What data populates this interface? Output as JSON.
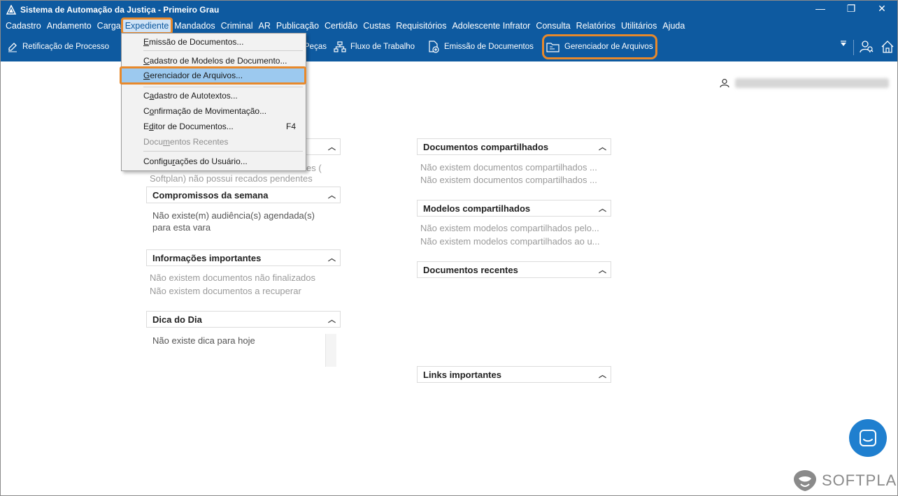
{
  "window": {
    "title": "Sistema de Automação da Justiça - Primeiro Grau",
    "controls": {
      "minimize": "—",
      "maximize": "❐",
      "close": "✕"
    }
  },
  "menubar": {
    "items": [
      "Cadastro",
      "Andamento",
      "Carga",
      "Expediente",
      "Mandados",
      "Criminal",
      "AR",
      "Publicação",
      "Certidão",
      "Custas",
      "Requisitórios",
      "Adolescente Infrator",
      "Consulta",
      "Relatórios",
      "Utilitários",
      "Ajuda"
    ],
    "active": "Expediente"
  },
  "toolbar": {
    "retificacao": "Retificação de Processo",
    "pecas": "Peças",
    "fluxo": "Fluxo de Trabalho",
    "emissao": "Emissão de Documentos",
    "gerenciador": "Gerenciador de Arquivos"
  },
  "dropdown": {
    "items": [
      {
        "label": "Emissão de Documentos...",
        "mnemonic": "E",
        "rest": "missão de Documentos..."
      },
      {
        "label": "Cadastro de Modelos de Documento...",
        "mnemonic": "C",
        "rest": "adastro de Modelos de Documento..."
      },
      {
        "label": "Gerenciador de Arquivos...",
        "mnemonic": "G",
        "rest": "erenciador de Arquivos..."
      },
      {
        "label": "Cadastro de Autotextos...",
        "pre": "C",
        "mnemonic": "a",
        "rest": "dastro de Autotextos..."
      },
      {
        "label": "Confirmação de Movimentação...",
        "pre": "C",
        "mnemonic": "o",
        "rest": "nfirmação de Movimentação..."
      },
      {
        "label": "Editor de Documentos...",
        "pre": "E",
        "mnemonic": "d",
        "rest": "itor de Documentos...",
        "shortcut": "F4"
      },
      {
        "label": "Documentos Recentes",
        "pre": "Docu",
        "mnemonic": "m",
        "rest": "entos Recentes"
      },
      {
        "label": "Configurações do Usuário...",
        "pre": "Configu",
        "mnemonic": "r",
        "rest": "ações do Usuário..."
      }
    ]
  },
  "left_panels": {
    "recados_line1_tail": "es (",
    "recados_line2": "Softplan) não possui recados pendentes",
    "compromissos": {
      "title": "Compromissos da semana",
      "text": "Não existe(m) audiência(s) agendada(s) para esta vara"
    },
    "informacoes": {
      "title": "Informações importantes",
      "lines": [
        "Não existem documentos não finalizados",
        "Não existem documentos a recuperar"
      ]
    },
    "dica": {
      "title": "Dica do Dia",
      "text": "Não existe dica para hoje"
    }
  },
  "right_panels": {
    "compartilhados": {
      "title": "Documentos compartilhados",
      "lines": [
        "Não existem documentos compartilhados ...",
        "Não existem documentos compartilhados ..."
      ]
    },
    "modelos": {
      "title": "Modelos compartilhados",
      "lines": [
        "Não existem modelos compartilhados pelo...",
        "Não existem modelos compartilhados ao u..."
      ]
    },
    "recentes": {
      "title": "Documentos recentes"
    },
    "links": {
      "title": "Links importantes"
    }
  },
  "brand": {
    "name": "SOFTPLAN"
  },
  "colors": {
    "primary": "#0e5aa0",
    "highlight": "#e8892b",
    "menu_hover": "#9cc9ef"
  }
}
